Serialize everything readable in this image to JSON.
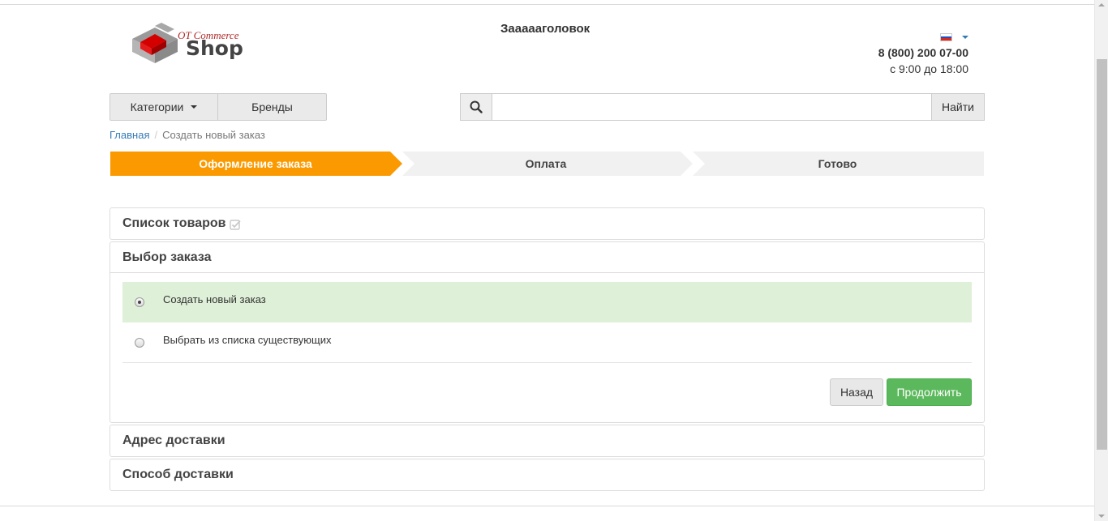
{
  "header": {
    "logo": {
      "top_text": "OT Commerce",
      "main_text": "Shop"
    },
    "site_title": "Заааааголовок",
    "language": {
      "icon": "russia-flag-icon",
      "colors": [
        "#ffffff",
        "#1d4fc4",
        "#d52b1e"
      ]
    },
    "phone": "8 (800) 200 07-00",
    "hours": "с 9:00 до 18:00"
  },
  "nav": {
    "categories_label": "Категории",
    "brands_label": "Бренды"
  },
  "search": {
    "icon": "search-icon",
    "value": "",
    "placeholder": "",
    "button_label": "Найти"
  },
  "breadcrumb": {
    "home": "Главная",
    "separator": "/",
    "current": "Создать новый заказ"
  },
  "steps": [
    {
      "label": "Оформление заказа",
      "active": true
    },
    {
      "label": "Оплата",
      "active": false
    },
    {
      "label": "Готово",
      "active": false
    }
  ],
  "colors": {
    "step_active": "#fb9a00",
    "step_inactive": "#f1f1f1",
    "selected_option": "#dff0d8",
    "primary_button": "#5cb85c",
    "link": "#337ab7"
  },
  "sections": {
    "items_list": {
      "title": "Список товаров",
      "icon": "check-square-icon"
    },
    "order_choice": {
      "title": "Выбор заказа",
      "options": [
        {
          "label": "Создать новый заказ",
          "selected": true
        },
        {
          "label": "Выбрать из списка существующих",
          "selected": false
        }
      ],
      "back_label": "Назад",
      "continue_label": "Продолжить"
    },
    "delivery_address": {
      "title": "Адрес доставки"
    },
    "delivery_method": {
      "title": "Способ доставки"
    }
  }
}
